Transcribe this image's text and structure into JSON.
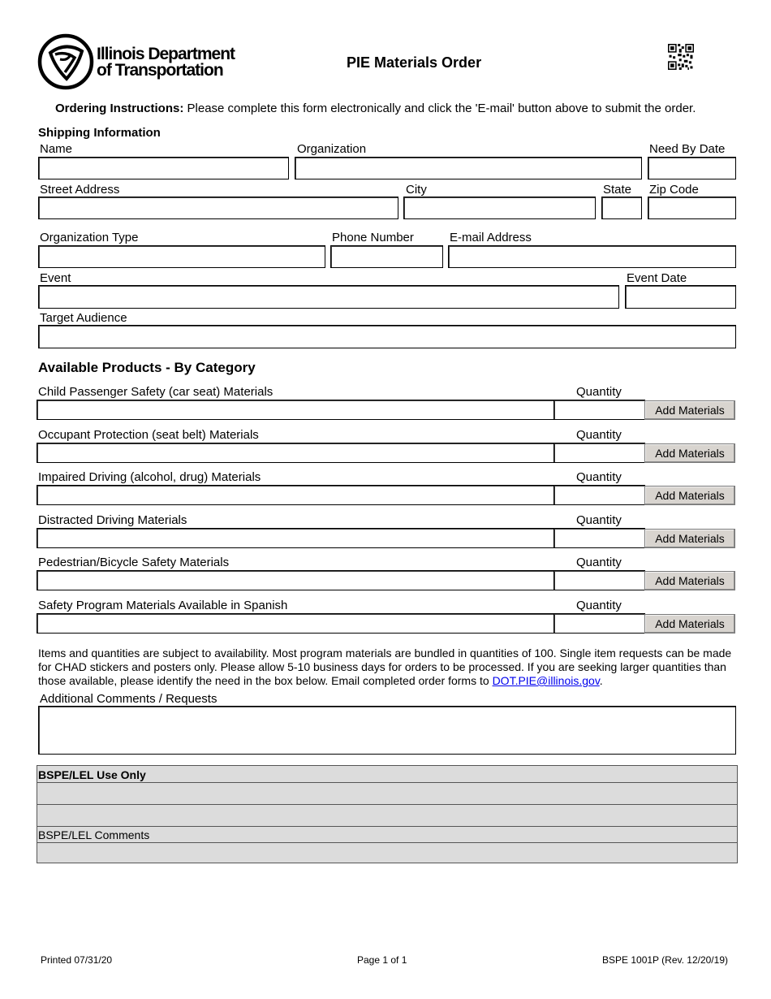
{
  "header": {
    "logo_text_line1": "Illinois Department",
    "logo_text_line2": "of Transportation",
    "logo_icon": "idot-tri-loop-logo",
    "title": "PIE Materials Order",
    "qr_icon": "qr-code"
  },
  "instructions": {
    "label": "Ordering Instructions:",
    "text": " Please complete this form electronically and click the 'E-mail' button above to submit the order."
  },
  "shipping": {
    "heading": "Shipping Information",
    "fields": {
      "name": {
        "label": "Name",
        "value": ""
      },
      "organization": {
        "label": "Organization",
        "value": ""
      },
      "need_by_date": {
        "label": "Need By Date",
        "value": ""
      },
      "street_address": {
        "label": "Street Address",
        "value": ""
      },
      "city": {
        "label": "City",
        "value": ""
      },
      "state": {
        "label": "State",
        "value": ""
      },
      "zip_code": {
        "label": "Zip Code",
        "value": ""
      },
      "organization_type": {
        "label": "Organization Type",
        "value": ""
      },
      "phone_number": {
        "label": "Phone Number",
        "value": ""
      },
      "email_address": {
        "label": "E-mail Address",
        "value": ""
      },
      "event": {
        "label": "Event",
        "value": ""
      },
      "event_date": {
        "label": "Event Date",
        "value": ""
      },
      "target_audience": {
        "label": "Target Audience",
        "value": ""
      }
    }
  },
  "products": {
    "heading": "Available Products - By Category",
    "quantity_label": "Quantity",
    "add_button_label": "Add Materials",
    "categories": [
      {
        "label": "Child Passenger Safety (car seat) Materials",
        "value": "",
        "quantity": ""
      },
      {
        "label": "Occupant Protection (seat belt) Materials",
        "value": "",
        "quantity": ""
      },
      {
        "label": "Impaired Driving (alcohol, drug) Materials",
        "value": "",
        "quantity": ""
      },
      {
        "label": "Distracted Driving Materials",
        "value": "",
        "quantity": ""
      },
      {
        "label": "Pedestrian/Bicycle Safety Materials",
        "value": "",
        "quantity": ""
      },
      {
        "label": "Safety Program Materials Available in Spanish",
        "value": "",
        "quantity": ""
      }
    ]
  },
  "notice": {
    "text": "Items and quantities are subject to availability. Most program materials are bundled in quantities of 100. Single item requests can be made for CHAD stickers and posters only. Please allow 5-10 business days for orders to be processed. If you are seeking larger quantities than those available, please identify the need in the box below. Email completed order forms to ",
    "email_link": "DOT.PIE@illinois.gov",
    "trailing": "."
  },
  "comments": {
    "label": "Additional Comments / Requests",
    "value": ""
  },
  "office_use": {
    "heading": "BSPE/LEL Use Only",
    "comments_label": "BSPE/LEL Comments"
  },
  "footer": {
    "printed": "Printed 07/31/20",
    "page": "Page 1 of 1",
    "form_id": "BSPE 1001P (Rev. 12/20/19)"
  }
}
